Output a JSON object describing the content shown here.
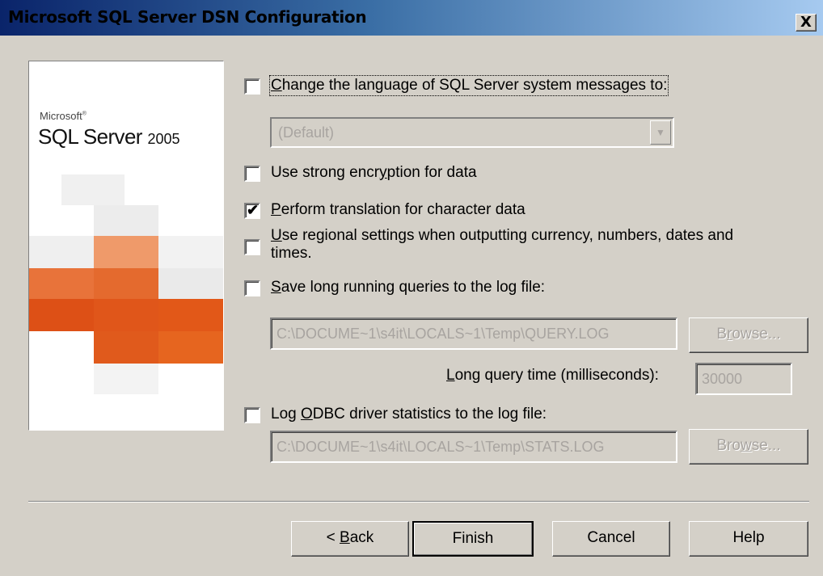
{
  "window": {
    "title": "Microsoft SQL Server DSN Configuration",
    "close_label": "X"
  },
  "banner": {
    "brand": "Microsoft",
    "product": "SQL Server",
    "version": "2005",
    "accent_color": "#e0561a"
  },
  "options": {
    "change_language": {
      "pre": "",
      "key": "C",
      "post": "hange the language of SQL Server system messages to:",
      "checked": false
    },
    "language_select": {
      "value": "(Default)",
      "enabled": false
    },
    "strong_encryption": {
      "pre": "Use strong encr",
      "key": "y",
      "post": "ption for data",
      "checked": false
    },
    "translation": {
      "pre": "",
      "key": "P",
      "post": "erform translation for character data",
      "checked": true
    },
    "regional_settings": {
      "line1_pre": "",
      "line1_key": "U",
      "line1_post": "se regional settings when outputting currency, numbers, dates and",
      "line2": "times.",
      "checked": false
    },
    "save_long_queries": {
      "pre": "",
      "key": "S",
      "post": "ave long running queries to the log file:",
      "checked": false
    },
    "query_log_path": "C:\\DOCUME~1\\s4it\\LOCALS~1\\Temp\\QUERY.LOG",
    "browse1": {
      "pre": "B",
      "key": "r",
      "post": "owse..."
    },
    "long_query_time": {
      "pre": "",
      "key": "L",
      "post": "ong query time (milliseconds):",
      "value": "30000"
    },
    "log_odbc_stats": {
      "pre": "Log ",
      "key": "O",
      "post": "DBC driver statistics to the log file:",
      "checked": false
    },
    "stats_log_path": "C:\\DOCUME~1\\s4it\\LOCALS~1\\Temp\\STATS.LOG",
    "browse2": {
      "pre": "Bro",
      "key": "w",
      "post": "se..."
    }
  },
  "buttons": {
    "back": {
      "pre": "< ",
      "key": "B",
      "post": "ack"
    },
    "finish": "Finish",
    "cancel": "Cancel",
    "help": "Help"
  }
}
